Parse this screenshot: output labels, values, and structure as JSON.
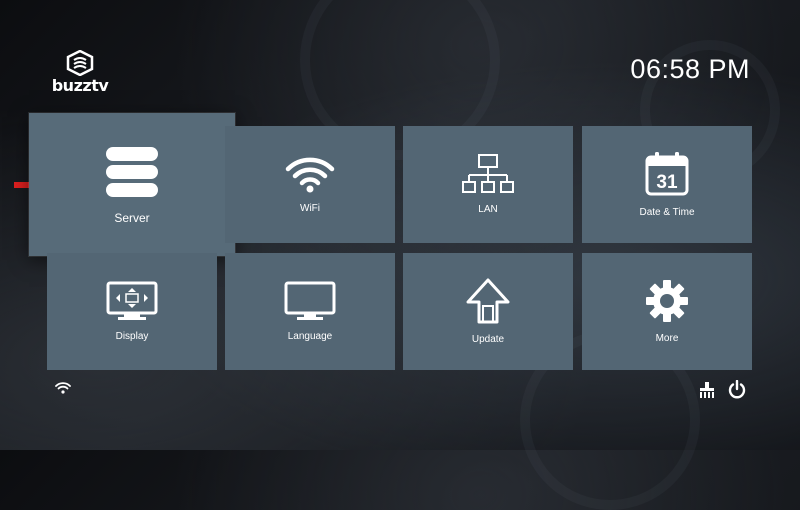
{
  "brand": {
    "name": "buzztv"
  },
  "clock": {
    "time": "06:58 PM"
  },
  "tiles": [
    {
      "label": "Server",
      "icon": "database-icon",
      "focused": true
    },
    {
      "label": "WiFi",
      "icon": "wifi-icon"
    },
    {
      "label": "LAN",
      "icon": "network-icon"
    },
    {
      "label": "Date & Time",
      "icon": "calendar-icon",
      "icon_text": "31"
    },
    {
      "label": "Display",
      "icon": "display-icon"
    },
    {
      "label": "Language",
      "icon": "monitor-icon"
    },
    {
      "label": "Update",
      "icon": "update-arrow-icon"
    },
    {
      "label": "More",
      "icon": "gear-icon"
    }
  ],
  "status_bar": {
    "left": [
      "wifi-icon"
    ],
    "right": [
      "cleaner-icon",
      "power-icon"
    ]
  },
  "colors": {
    "tile": "#536674",
    "arrow": "#e02020",
    "text": "#ffffff"
  }
}
